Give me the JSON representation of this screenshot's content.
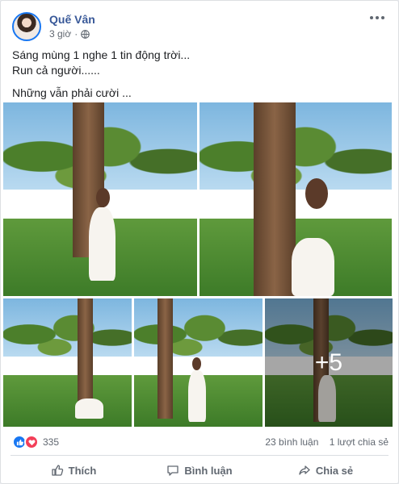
{
  "post": {
    "author": "Quế Vân",
    "time": "3 giờ",
    "privacy_icon": "globe-icon",
    "more_icon": "more-options-icon",
    "lines": [
      "Sáng mùng 1 nghe 1 tin động trời...",
      "Run cả người......",
      "Những vẫn phải cười ..."
    ]
  },
  "photos": {
    "count": 5,
    "more_overlay": "+5"
  },
  "reactions": {
    "icons": [
      "like-reaction-icon",
      "love-reaction-icon"
    ],
    "count": "335",
    "comments": "23 bình luận",
    "shares": "1 lượt chia sẻ"
  },
  "actions": {
    "like": "Thích",
    "comment": "Bình luận",
    "share": "Chia sẻ"
  },
  "colors": {
    "name": "#385898",
    "like": "#1877f2",
    "love": "#f33e58",
    "muted": "#606770"
  }
}
